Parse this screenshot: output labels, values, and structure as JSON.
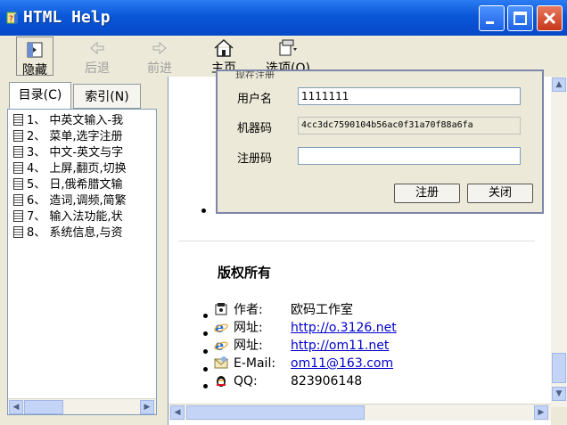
{
  "window": {
    "title": "HTML Help"
  },
  "toolbar": {
    "hide": "隐藏",
    "back": "后退",
    "forward": "前进",
    "home": "主页",
    "options": "选项(O)"
  },
  "tabs": {
    "contents": "目录(C)",
    "index": "索引(N)"
  },
  "toc": [
    "1、 中英文输入-我",
    "2、 菜单,选字注册",
    "3、 中文-英文与字",
    "4、 上屏,翻页,切换",
    "5、 日,俄希腊文输",
    "6、 造词,调频,简繁",
    "7、 输入法功能,状",
    "8、 系统信息,与资"
  ],
  "dialog": {
    "group_title": "现在注册",
    "username_label": "用户名",
    "username_value": "1111111",
    "machine_label": "机器码",
    "machine_value": "4cc3dc7590104b56ac0f31a70f88a6fa",
    "regcode_label": "注册码",
    "regcode_value": "",
    "register_button": "注册",
    "close_button": "关闭"
  },
  "copyright": {
    "title": "版权所有",
    "author_label": "作者:",
    "author_value": "欧码工作室",
    "site1_label": "网址:",
    "site1_value": "http://o.3126.net",
    "site2_label": "网址:",
    "site2_value": "http://om11.net",
    "email_label": "E-Mail:",
    "email_value": "om11@163.com",
    "qq_label": "QQ:",
    "qq_value": "823906148"
  },
  "colors": {
    "titlebar": "#0a57d8",
    "link": "#0000cc",
    "close_button": "#c7351a"
  }
}
